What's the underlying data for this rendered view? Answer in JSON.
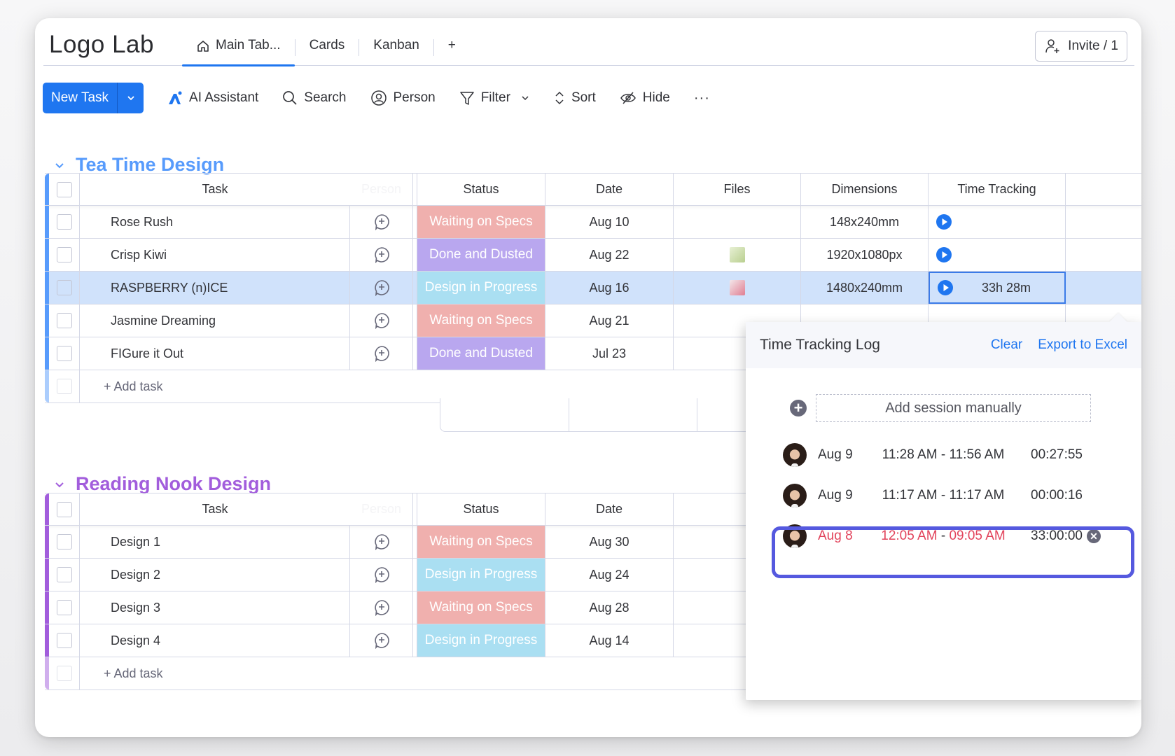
{
  "board": {
    "title": "Logo Lab",
    "tabs": [
      {
        "label": "Main Tab...",
        "icon": "home-icon",
        "active": true
      },
      {
        "label": "Cards",
        "active": false
      },
      {
        "label": "Kanban",
        "active": false
      }
    ],
    "add_tab": "+",
    "invite_label": "Invite / 1"
  },
  "toolbar": {
    "new_task": "New Task",
    "ai_assistant": "AI Assistant",
    "search": "Search",
    "person": "Person",
    "filter": "Filter",
    "sort": "Sort",
    "hide": "Hide",
    "more": "···"
  },
  "columns": {
    "task": "Task",
    "person": "Person",
    "status": "Status",
    "date": "Date",
    "files": "Files",
    "dimensions": "Dimensions",
    "time_tracking": "Time Tracking"
  },
  "status_colors": {
    "Waiting on Specs": "#f0b0ae",
    "Done and Dusted": "#b9a7ef",
    "Design in Progress": "#aadff2"
  },
  "groups": [
    {
      "title": "Tea Time Design",
      "color": "#579bfc",
      "rows": [
        {
          "task": "Rose Rush",
          "status": "Waiting on Specs",
          "date": "Aug 10",
          "file": "",
          "dimensions": "148x240mm",
          "time": ""
        },
        {
          "task": "Crisp Kiwi",
          "status": "Done and Dusted",
          "date": "Aug 22",
          "file": "green-thumbnail",
          "dimensions": "1920x1080px",
          "time": ""
        },
        {
          "task": "RASPBERRY (n)ICE",
          "status": "Design in Progress",
          "date": "Aug 16",
          "file": "pink-thumbnail",
          "dimensions": "1480x240mm",
          "time": "33h 28m",
          "selected": true
        },
        {
          "task": "Jasmine Dreaming",
          "status": "Waiting on Specs",
          "date": "Aug 21"
        },
        {
          "task": "FIGure it Out",
          "status": "Done and Dusted",
          "date": "Jul 23"
        }
      ],
      "add_task": "+ Add task"
    },
    {
      "title": "Reading Nook Design",
      "color": "#a25ddc",
      "rows": [
        {
          "task": "Design 1",
          "status": "Waiting on Specs",
          "date": "Aug 30"
        },
        {
          "task": "Design 2",
          "status": "Design in Progress",
          "date": "Aug 24"
        },
        {
          "task": "Design 3",
          "status": "Waiting on Specs",
          "date": "Aug 28"
        },
        {
          "task": "Design 4",
          "status": "Design in Progress",
          "date": "Aug 14"
        }
      ],
      "add_task": "+ Add task"
    }
  ],
  "time_log": {
    "title": "Time Tracking Log",
    "clear": "Clear",
    "export": "Export to Excel",
    "add_session": "Add session manually",
    "sessions": [
      {
        "date": "Aug 9",
        "start": "11:28 AM",
        "end": "11:56 AM",
        "duration": "00:27:55"
      },
      {
        "date": "Aug 9",
        "start": "11:17 AM",
        "end": "11:17 AM",
        "duration": "00:00:16"
      },
      {
        "date": "Aug 8",
        "start": "12:05 AM",
        "end": "09:05 AM",
        "duration": "33:00:00",
        "highlighted": true
      }
    ],
    "separator": "-"
  }
}
